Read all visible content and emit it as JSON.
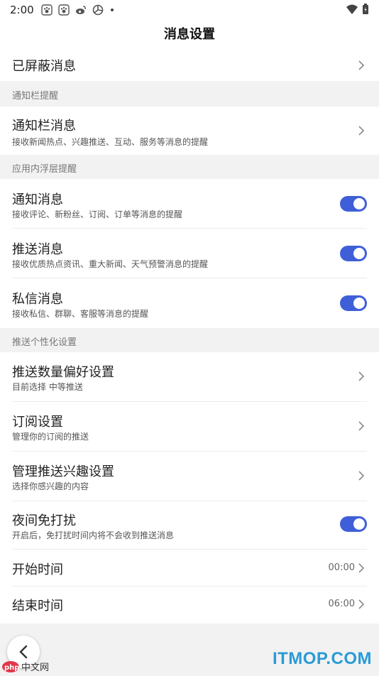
{
  "status_bar": {
    "time": "2:00"
  },
  "header": {
    "title": "消息设置"
  },
  "blocked": {
    "label": "已屏蔽消息"
  },
  "section_notify_bar": {
    "label": "通知栏提醒"
  },
  "notify_bar_item": {
    "label": "通知栏消息",
    "desc": "接收新闻热点、兴趣推送、互动、服务等消息的提醒"
  },
  "section_in_app": {
    "label": "应用内浮层提醒"
  },
  "in_app_items": [
    {
      "label": "通知消息",
      "desc": "接收评论、新粉丝、订阅、订单等消息的提醒",
      "enabled": true
    },
    {
      "label": "推送消息",
      "desc": "接收优质热点资讯、重大新闻、天气预警消息的提醒",
      "enabled": true
    },
    {
      "label": "私信消息",
      "desc": "接收私信、群聊、客服等消息的提醒",
      "enabled": true
    }
  ],
  "section_push": {
    "label": "推送个性化设置"
  },
  "push_items": [
    {
      "label": "推送数量偏好设置",
      "desc": "目前选择 中等推送"
    },
    {
      "label": "订阅设置",
      "desc": "管理你的订阅的推送"
    },
    {
      "label": "管理推送兴趣设置",
      "desc": "选择你感兴趣的内容"
    }
  ],
  "dnd": {
    "label": "夜间免打扰",
    "desc": "开启后，免打扰时间内将不会收到推送消息",
    "enabled": true
  },
  "start_time": {
    "label": "开始时间",
    "value": "00:00"
  },
  "end_time": {
    "label": "结束时间",
    "value": "06:00"
  },
  "watermark": {
    "left": "中文网",
    "right": "ITMOP.COM"
  },
  "colors": {
    "toggle_on": "#3f5fd9",
    "background": "#f2f2f2",
    "watermark": "#2a9bd6"
  }
}
